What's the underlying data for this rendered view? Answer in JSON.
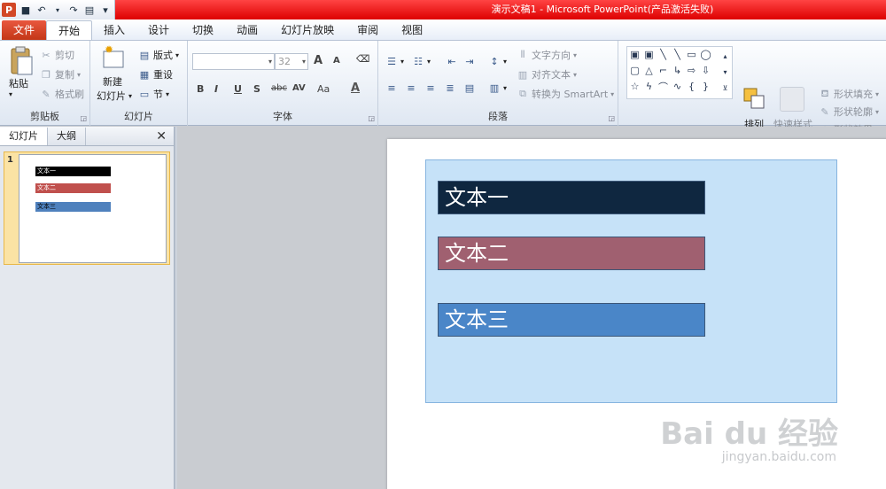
{
  "window": {
    "title": "演示文稿1 - Microsoft PowerPoint(产品激活失败)",
    "app_logo": "P",
    "accent": "#e00000"
  },
  "qat": {
    "save_icon": "💾",
    "undo_icon": "↶",
    "redo_icon": "↷",
    "extra_icon": "▾"
  },
  "tabs": {
    "file": "文件",
    "items": [
      "开始",
      "插入",
      "设计",
      "切换",
      "动画",
      "幻灯片放映",
      "审阅",
      "视图"
    ],
    "active_index": 0
  },
  "ribbon": {
    "clipboard": {
      "label": "剪贴板",
      "paste": "粘贴",
      "cut": "剪切",
      "copy": "复制",
      "format_painter": "格式刷"
    },
    "slides": {
      "label": "幻灯片",
      "new_slide": "新建",
      "new_slide_line2": "幻灯片",
      "layout": "版式",
      "reset": "重设",
      "section": "节"
    },
    "font": {
      "label": "字体",
      "font_name": "",
      "font_size": "32",
      "grow": "A",
      "shrink": "A",
      "bold": "B",
      "italic": "I",
      "underline": "U",
      "shadow": "S",
      "strike": "abc",
      "spacing": "AV",
      "case": "Aa",
      "color": "A"
    },
    "paragraph": {
      "label": "段落",
      "text_direction": "文字方向",
      "align_text": "对齐文本",
      "smartart": "转换为 SmartArt"
    },
    "drawing": {
      "label": "绘图",
      "arrange": "排列",
      "quick_styles": "快速样式",
      "shape_fill": "形状填充",
      "shape_outline": "形状轮廓",
      "shape_effects": "形状效果"
    }
  },
  "left_panel": {
    "tab_slides": "幻灯片",
    "tab_outline": "大纲",
    "close": "✕",
    "slide_number": "1"
  },
  "slide": {
    "boxes": [
      {
        "text": "文本一",
        "fill": "#0f2740"
      },
      {
        "text": "文本二",
        "fill": "#a06070"
      },
      {
        "text": "文本三",
        "fill": "#4a86c8"
      }
    ],
    "group_fill": "#c6e2f8"
  },
  "watermark": {
    "brand": "Bai du 经验",
    "url": "jingyan.baidu.com"
  }
}
